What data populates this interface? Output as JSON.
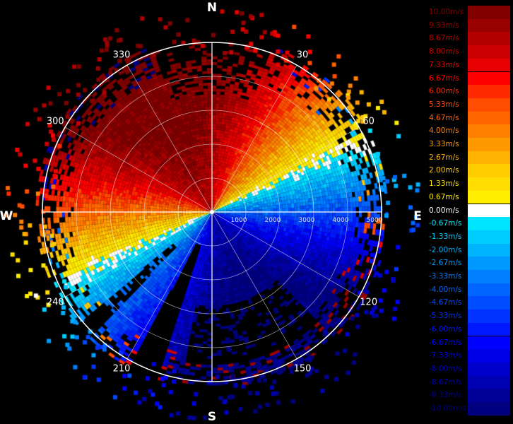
{
  "compass": {
    "north": "N",
    "east": "E",
    "south": "S",
    "west": "W"
  },
  "angles": [
    {
      "label": "30",
      "deg": 30
    },
    {
      "label": "60",
      "deg": 60
    },
    {
      "label": "120",
      "deg": 120
    },
    {
      "label": "150",
      "deg": 150
    },
    {
      "label": "210",
      "deg": 210
    },
    {
      "label": "240",
      "deg": 240
    },
    {
      "label": "300",
      "deg": 300
    },
    {
      "label": "330",
      "deg": 330
    }
  ],
  "range_labels": [
    "1000",
    "2000",
    "3000",
    "4000",
    "5000"
  ],
  "legend": {
    "items": [
      {
        "label": "10.00m/s",
        "color": "#800000"
      },
      {
        "label": "9.33m/s",
        "color": "#990000"
      },
      {
        "label": "8.67m/s",
        "color": "#b30000"
      },
      {
        "label": "8.00m/s",
        "color": "#cc0000"
      },
      {
        "label": "7.33m/s",
        "color": "#e60000"
      },
      {
        "label": "6.67m/s",
        "color": "#ff0000"
      },
      {
        "label": "6.00m/s",
        "color": "#ff2a00"
      },
      {
        "label": "5.33m/s",
        "color": "#ff4d00"
      },
      {
        "label": "4.67m/s",
        "color": "#ff6600"
      },
      {
        "label": "4.00m/s",
        "color": "#ff8000"
      },
      {
        "label": "3.33m/s",
        "color": "#ff9900"
      },
      {
        "label": "2.67m/s",
        "color": "#ffb300"
      },
      {
        "label": "2.00m/s",
        "color": "#ffcc00"
      },
      {
        "label": "1.33m/s",
        "color": "#ffdd00"
      },
      {
        "label": "0.67m/s",
        "color": "#ffee00"
      },
      {
        "label": "0.00m/s",
        "color": "#ffffff"
      },
      {
        "label": "-0.67m/s",
        "color": "#00e5ff"
      },
      {
        "label": "-1.33m/s",
        "color": "#00ccff"
      },
      {
        "label": "-2.00m/s",
        "color": "#00b3ff"
      },
      {
        "label": "-2.67m/s",
        "color": "#0099ff"
      },
      {
        "label": "-3.33m/s",
        "color": "#0080ff"
      },
      {
        "label": "-4.00m/s",
        "color": "#0066ff"
      },
      {
        "label": "-4.67m/s",
        "color": "#004dff"
      },
      {
        "label": "-5.33m/s",
        "color": "#0033ff"
      },
      {
        "label": "-6.00m/s",
        "color": "#001aff"
      },
      {
        "label": "-6.67m/s",
        "color": "#0000ff"
      },
      {
        "label": "-7.33m/s",
        "color": "#0000e6"
      },
      {
        "label": "-8.00m/s",
        "color": "#0000cc"
      },
      {
        "label": "-8.67m/s",
        "color": "#0000b3"
      },
      {
        "label": "-9.33m/s",
        "color": "#000099"
      },
      {
        "label": "-10.00m/s",
        "color": "#000080"
      }
    ]
  }
}
